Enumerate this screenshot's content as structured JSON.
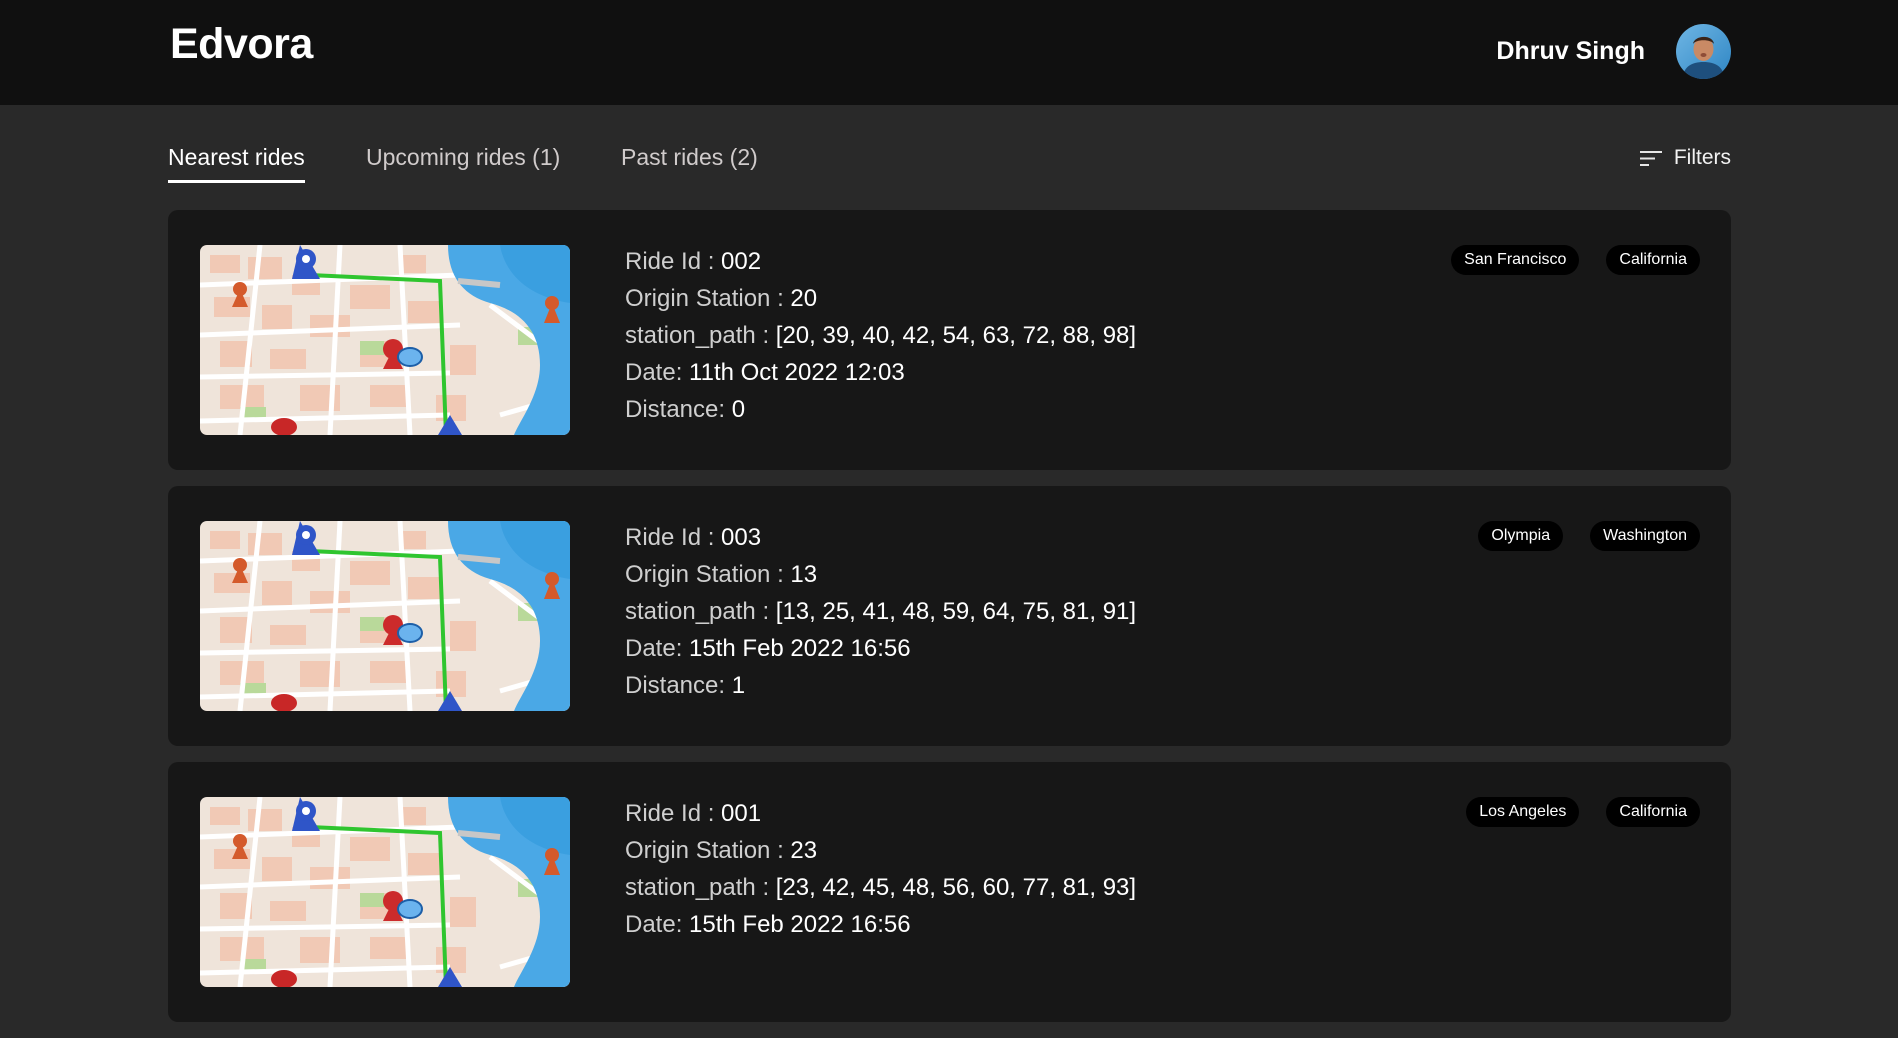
{
  "header": {
    "brand": "Edvora",
    "user_name": "Dhruv Singh"
  },
  "tabs": [
    {
      "label": "Nearest rides",
      "active": true
    },
    {
      "label": "Upcoming rides (1)",
      "active": false
    },
    {
      "label": "Past rides (2)",
      "active": false
    }
  ],
  "filters": {
    "label": "Filters",
    "icon": "filter-lines-icon"
  },
  "labels": {
    "ride_id": "Ride Id : ",
    "origin_station": "Origin Station : ",
    "station_path": "station_path : ",
    "date": "Date: ",
    "distance": "Distance: "
  },
  "rides": [
    {
      "ride_id": "002",
      "origin_station": "20",
      "station_path": "[20, 39, 40, 42, 54, 63, 72, 88, 98]",
      "date": "11th Oct 2022 12:03",
      "distance": "0",
      "city": "San Francisco",
      "state": "California"
    },
    {
      "ride_id": "003",
      "origin_station": "13",
      "station_path": "[13, 25, 41, 48, 59, 64, 75, 81, 91]",
      "date": "15th Feb 2022 16:56",
      "distance": "1",
      "city": "Olympia",
      "state": "Washington"
    },
    {
      "ride_id": "001",
      "origin_station": "23",
      "station_path": "[23, 42, 45, 48, 56, 60, 77, 81, 93]",
      "date": "15th Feb 2022 16:56",
      "distance": "",
      "city": "Los Angeles",
      "state": "California"
    }
  ],
  "colors": {
    "page_bg": "#292929",
    "header_bg": "#101010",
    "card_bg": "#171717",
    "tag_bg": "#000000",
    "route": "#2fc52f",
    "river": "#3a9fe0"
  }
}
